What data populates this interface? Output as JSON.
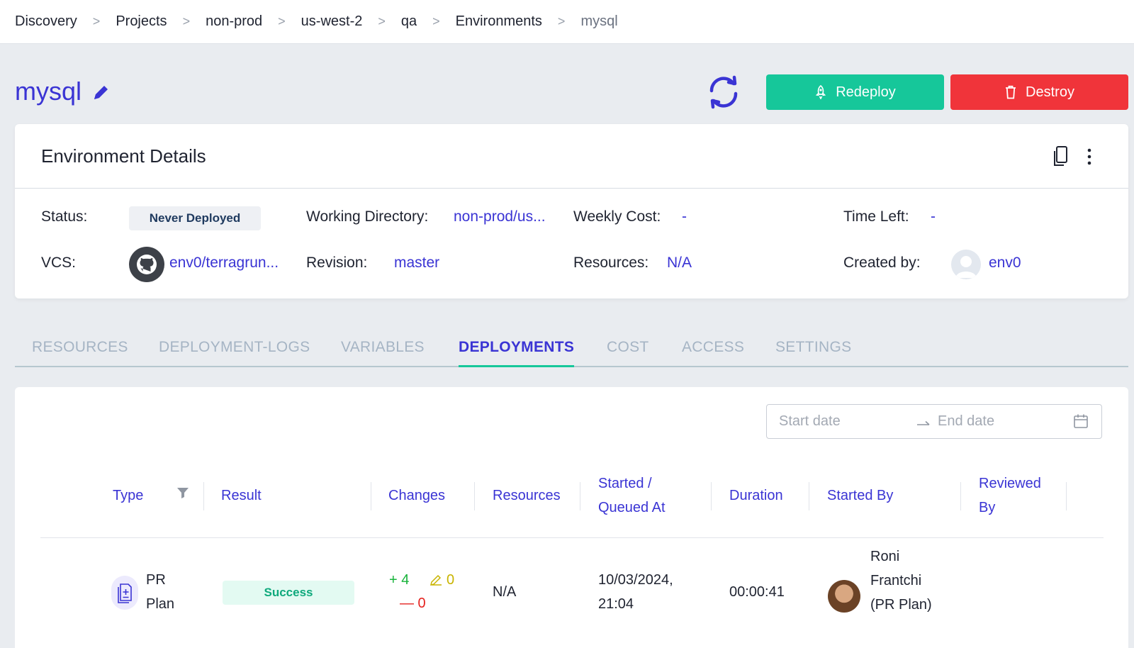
{
  "breadcrumb": [
    "Discovery",
    "Projects",
    "non-prod",
    "us-west-2",
    "qa",
    "Environments",
    "mysql"
  ],
  "breadcrumb_separator": ">",
  "environment": {
    "name": "mysql",
    "redeploy_label": "Redeploy",
    "destroy_label": "Destroy"
  },
  "details": {
    "title": "Environment Details",
    "status_label": "Status:",
    "status_value": "Never Deployed",
    "working_dir_label": "Working Directory:",
    "working_dir_value": "non-prod/us...",
    "weekly_cost_label": "Weekly Cost:",
    "weekly_cost_value": "-",
    "time_left_label": "Time Left:",
    "time_left_value": "-",
    "vcs_label": "VCS:",
    "vcs_value": "env0/terragrun...",
    "revision_label": "Revision:",
    "revision_value": "master",
    "resources_label": "Resources:",
    "resources_value": "N/A",
    "created_by_label": "Created by:",
    "created_by_value": "env0"
  },
  "tabs": [
    "RESOURCES",
    "DEPLOYMENT-LOGS",
    "VARIABLES",
    "DEPLOYMENTS",
    "COST",
    "ACCESS",
    "SETTINGS"
  ],
  "active_tab": "DEPLOYMENTS",
  "date_range": {
    "start_placeholder": "Start date",
    "end_placeholder": "End date"
  },
  "table": {
    "columns": {
      "type": "Type",
      "result": "Result",
      "changes": "Changes",
      "resources": "Resources",
      "started_l1": "Started /",
      "started_l2": "Queued At",
      "duration": "Duration",
      "started_by": "Started By",
      "reviewed_l1": "Reviewed",
      "reviewed_l2": "By"
    },
    "rows": [
      {
        "type_l1": "PR",
        "type_l2": "Plan",
        "result": "Success",
        "added": "+ 4",
        "changed": "0",
        "destroyed": "— 0",
        "resources": "N/A",
        "started_l1": "10/03/2024,",
        "started_l2": "21:04",
        "duration": "00:00:41",
        "started_by_l1": "Roni",
        "started_by_l2": "Frantchi",
        "started_by_l3": "(PR Plan)",
        "reviewed_by": ""
      }
    ]
  },
  "colors": {
    "accent": "#3a34d4",
    "redeploy": "#16c79a",
    "destroy": "#f0343a",
    "success": "#0fa97c"
  }
}
